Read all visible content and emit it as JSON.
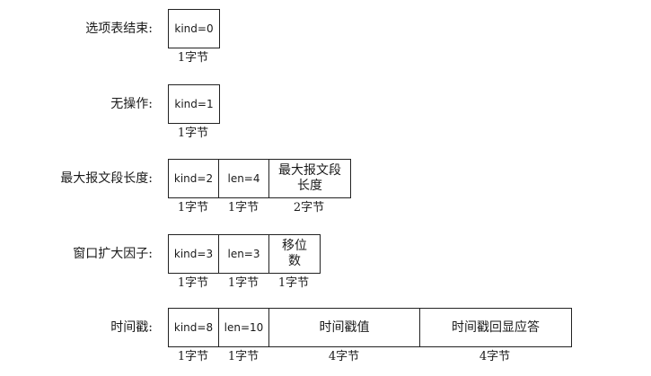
{
  "rows": [
    {
      "label": "选项表结束:",
      "cells": [
        {
          "text": "kind=0"
        }
      ],
      "sizes": [
        "1字节"
      ]
    },
    {
      "label": "无操作:",
      "cells": [
        {
          "text": "kind=1"
        }
      ],
      "sizes": [
        "1字节"
      ]
    },
    {
      "label": "最大报文段长度:",
      "cells": [
        {
          "text": "kind=2"
        },
        {
          "text": "len=4"
        },
        {
          "text": "最大报文段\n长度"
        }
      ],
      "sizes": [
        "1字节",
        "1字节",
        "2字节"
      ]
    },
    {
      "label": "窗口扩大因子:",
      "cells": [
        {
          "text": "kind=3"
        },
        {
          "text": "len=3"
        },
        {
          "text": "移位\n数"
        }
      ],
      "sizes": [
        "1字节",
        "1字节",
        "1字节"
      ]
    },
    {
      "label": "时间戳:",
      "cells": [
        {
          "text": "kind=8"
        },
        {
          "text": "len=10"
        },
        {
          "text": "时间戳值"
        },
        {
          "text": "时间戳回显应答"
        }
      ],
      "sizes": [
        "1字节",
        "1字节",
        "4字节",
        "4字节"
      ]
    }
  ]
}
